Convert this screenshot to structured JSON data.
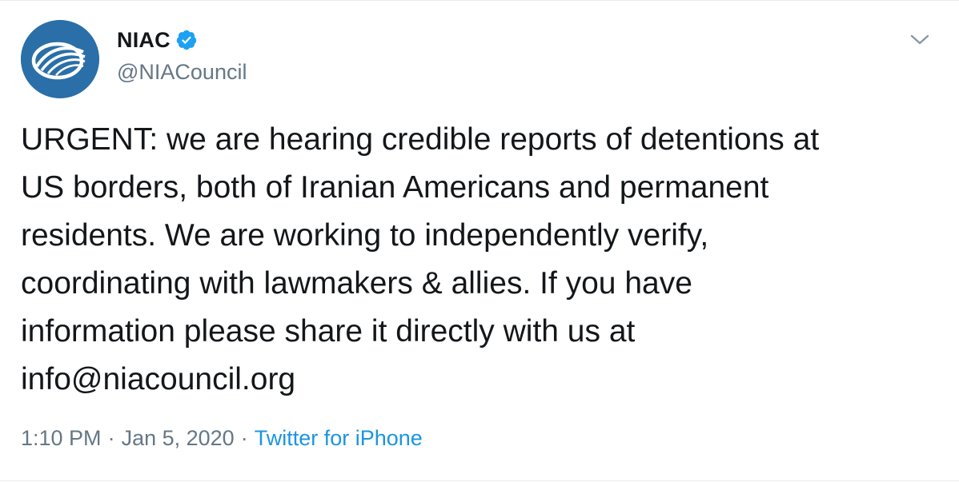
{
  "tweet": {
    "author": {
      "display_name": "NIAC",
      "handle": "@NIACouncil",
      "verified": true
    },
    "text": "URGENT: we are hearing credible reports of detentions at\nUS borders, both of Iranian Americans and permanent\nresidents. We are working to independently verify,\ncoordinating with lawmakers & allies. If you have\ninformation please share it directly with us at\ninfo@niacouncil.org",
    "time": "1:10 PM",
    "date": "Jan 5, 2020",
    "separator": "·",
    "source": "Twitter for iPhone"
  },
  "icons": {
    "avatar": "niac-logo-icon",
    "verified": "verified-badge-icon",
    "menu": "chevron-down-icon"
  },
  "colors": {
    "text": "#14171a",
    "secondary": "#657786",
    "link": "#1b95e0",
    "verified": "#1da1f2",
    "avatar_bg": "#2a6fa8"
  }
}
